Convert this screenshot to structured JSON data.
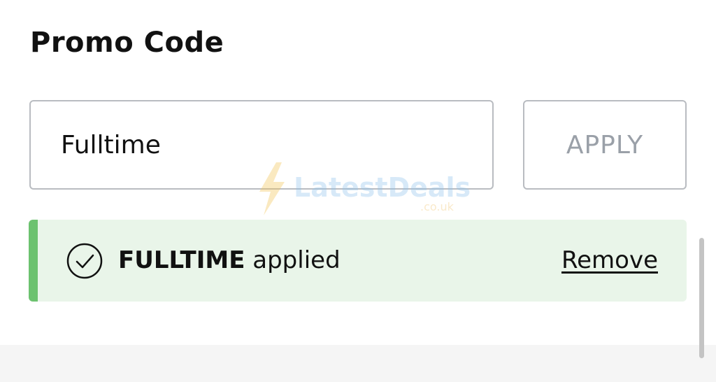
{
  "section": {
    "title": "Promo Code"
  },
  "promo_input": {
    "value": "Fulltime",
    "placeholder": ""
  },
  "apply_button": {
    "label": "APPLY"
  },
  "watermark": {
    "brand": "LatestDeals",
    "domain": ".co.uk"
  },
  "applied_banner": {
    "code": "FULLTIME",
    "status_text": "applied",
    "remove_label": "Remove",
    "icon": "check-circle-icon"
  },
  "colors": {
    "banner_background": "#e9f5e9",
    "banner_accent": "#6cc26f",
    "apply_text_disabled": "#9aa0a8",
    "border": "#b9bcc1"
  }
}
